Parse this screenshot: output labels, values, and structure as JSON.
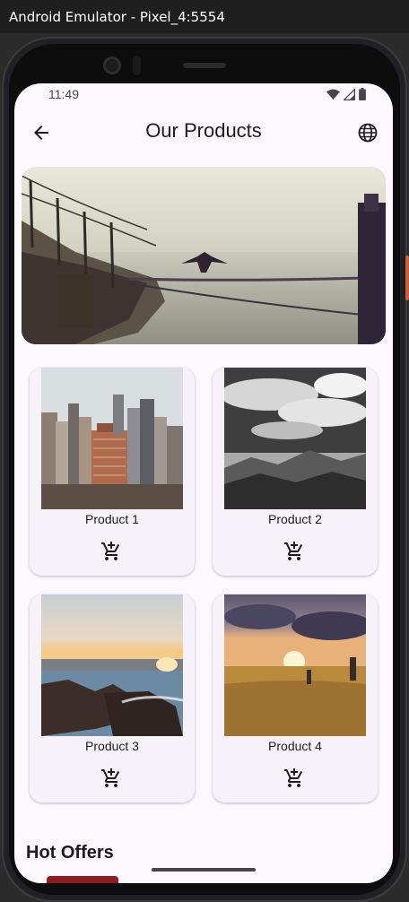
{
  "window": {
    "title": "Android Emulator - Pixel_4:5554"
  },
  "statusbar": {
    "time": "11:49"
  },
  "appbar": {
    "title": "Our Products"
  },
  "products": [
    {
      "name": "Product 1"
    },
    {
      "name": "Product 2"
    },
    {
      "name": "Product 3"
    },
    {
      "name": "Product 4"
    }
  ],
  "sections": {
    "hot_offers": "Hot Offers"
  },
  "colors": {
    "background": "#fdf7ff",
    "card": "#f7f2fa",
    "text": "#1d1b20"
  }
}
